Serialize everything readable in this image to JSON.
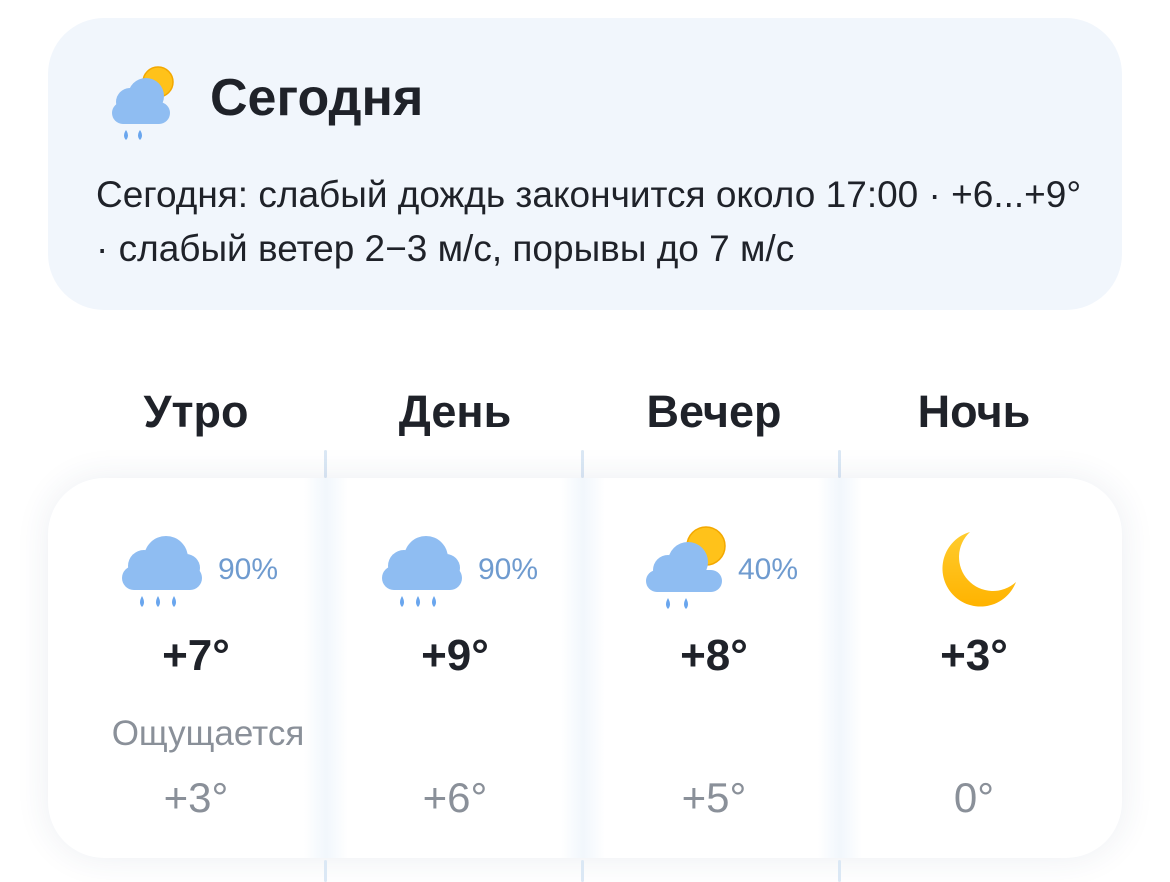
{
  "summary": {
    "icon": "cloud-sun-light-rain-icon",
    "title": "Сегодня",
    "text": "Сегодня: слабый дождь закончится около 17:00 · +6...+9° · слабый ветер 2−3 м/с, порывы до 7 м/с"
  },
  "feels_like_label": "Ощущается",
  "periods": [
    {
      "name": "Утро",
      "icon": "rain-cloud-icon",
      "precip": "90%",
      "temp": "+7°",
      "feels": "+3°"
    },
    {
      "name": "День",
      "icon": "rain-cloud-icon",
      "precip": "90%",
      "temp": "+9°",
      "feels": "+6°"
    },
    {
      "name": "Вечер",
      "icon": "cloud-sun-rain-icon",
      "precip": "40%",
      "temp": "+8°",
      "feels": "+5°"
    },
    {
      "name": "Ночь",
      "icon": "moon-icon",
      "precip": "",
      "temp": "+3°",
      "feels": "0°"
    }
  ],
  "colors": {
    "card_bg": "#f1f6fc",
    "cloud": "#8fbdf2",
    "drop": "#6aa6ee",
    "sun": "#ffc21a",
    "precip_text": "#6f9bcf",
    "muted_text": "#8a9099"
  }
}
